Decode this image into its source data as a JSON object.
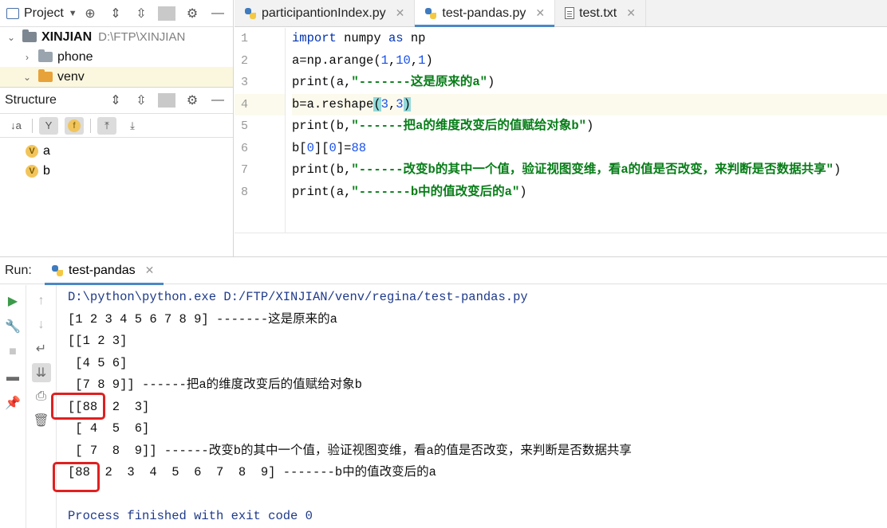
{
  "project_panel": {
    "title": "Project",
    "root": {
      "name": "XINJIAN",
      "path": "D:\\FTP\\XINJIAN"
    },
    "items": [
      {
        "name": "phone"
      },
      {
        "name": "venv"
      }
    ]
  },
  "structure_panel": {
    "title": "Structure",
    "vars": [
      {
        "badge": "V",
        "name": "a"
      },
      {
        "badge": "V",
        "name": "b"
      }
    ],
    "tool_f": "f"
  },
  "editor": {
    "tabs": [
      {
        "label": "participantionIndex.py"
      },
      {
        "label": "test-pandas.py"
      },
      {
        "label": "test.txt"
      }
    ],
    "line_numbers": [
      "1",
      "2",
      "3",
      "4",
      "5",
      "6",
      "7",
      "8"
    ],
    "code": {
      "l1": {
        "kw": "import",
        "a": " numpy ",
        "kw2": "as",
        "b": " np"
      },
      "l2": {
        "a": "a=np.arange(",
        "n1": "1",
        "c1": ",",
        "n2": "10",
        "c2": ",",
        "n3": "1",
        "z": ")"
      },
      "l3": {
        "a": "print(a,",
        "s": "\"-------这是原来的a\"",
        "z": ")"
      },
      "l4": {
        "a": "b=a.reshape",
        "p1": "(",
        "n1": "3",
        "c": ",",
        "n2": "3",
        "p2": ")"
      },
      "l5": {
        "a": "print(b,",
        "s": "\"------把a的维度改变后的值赋给对象b\"",
        "z": ")"
      },
      "l6": {
        "a": "b[",
        "n1": "0",
        "b": "][",
        "n2": "0",
        "c": "]=",
        "n3": "88"
      },
      "l7": {
        "a": "print(b,",
        "s": "\"------改变b的其中一个值，验证视图变维，看a的值是否改变，来判断是否数据共享\"",
        "z": ")"
      },
      "l8": {
        "a": "print(a,",
        "s": "\"-------b中的值改变后的a\"",
        "z": ")"
      }
    }
  },
  "run": {
    "label": "Run:",
    "tab": "test-pandas",
    "output": [
      "D:\\python\\python.exe D:/FTP/XINJIAN/venv/regina/test-pandas.py",
      "[1 2 3 4 5 6 7 8 9] -------这是原来的a",
      "[[1 2 3]",
      " [4 5 6]",
      " [7 8 9]] ------把a的维度改变后的值赋给对象b",
      "[[88  2  3]",
      " [ 4  5  6]",
      " [ 7  8  9]] ------改变b的其中一个值，验证视图变维，看a的值是否改变，来判断是否数据共享",
      "[88  2  3  4  5  6  7  8  9] -------b中的值改变后的a",
      "",
      "Process finished with exit code 0"
    ]
  }
}
